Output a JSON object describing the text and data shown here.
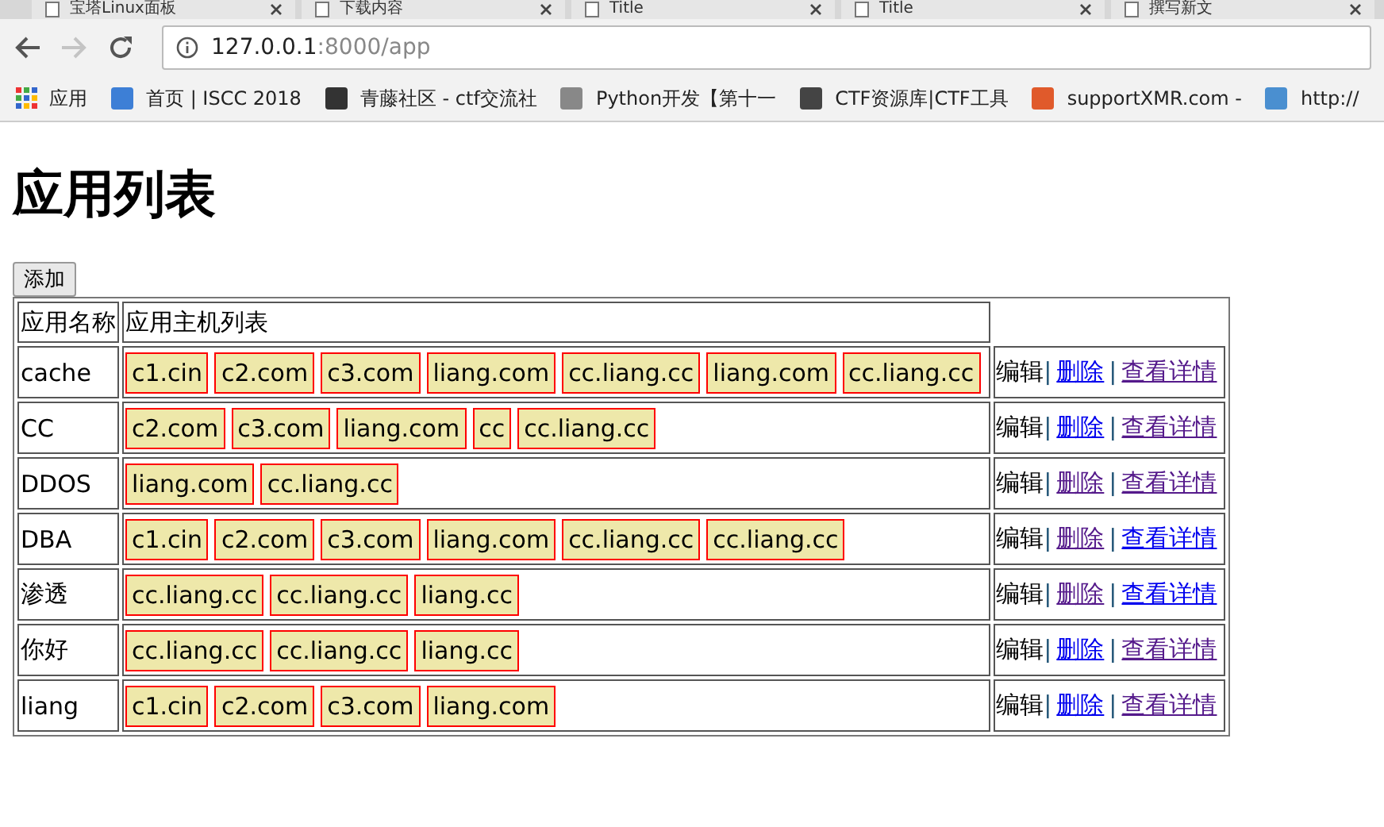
{
  "browser": {
    "tabs": [
      {
        "title": "宝塔Linux面板"
      },
      {
        "title": "下载内容"
      },
      {
        "title": "Title"
      },
      {
        "title": "Title"
      },
      {
        "title": "撰写新文"
      }
    ],
    "toolbar": {
      "forward_disabled": true,
      "address_host": "127.0.0.1",
      "address_path": ":8000/app"
    },
    "bookmarks": [
      {
        "label": "应用",
        "kind": "apps"
      },
      {
        "label": "首页 | ISCC 2018",
        "kind": "site"
      },
      {
        "label": "青藤社区 - ctf交流社",
        "kind": "site"
      },
      {
        "label": "Python开发【第十一",
        "kind": "site"
      },
      {
        "label": "CTF资源库|CTF工具",
        "kind": "site"
      },
      {
        "label": "supportXMR.com -",
        "kind": "site"
      },
      {
        "label": "http://",
        "kind": "site"
      }
    ]
  },
  "page": {
    "title": "应用列表",
    "add_button": "添加",
    "table": {
      "columns": [
        "应用名称",
        "应用主机列表"
      ],
      "rows": [
        {
          "name": "cache",
          "hosts": [
            "c1.cin",
            "c2.com",
            "c3.com",
            "liang.com",
            "cc.liang.cc",
            "liang.com",
            "cc.liang.cc"
          ],
          "actions": [
            {
              "kind": "text",
              "label": "编辑"
            },
            {
              "kind": "separator",
              "label": "|"
            },
            {
              "kind": "link",
              "label": "删除",
              "visited": false
            },
            {
              "kind": "separator",
              "label": "|"
            },
            {
              "kind": "link",
              "label": "查看详情",
              "visited": true
            }
          ]
        },
        {
          "name": "CC",
          "hosts": [
            "c2.com",
            "c3.com",
            "liang.com",
            "cc",
            "cc.liang.cc"
          ],
          "actions": [
            {
              "kind": "text",
              "label": "编辑"
            },
            {
              "kind": "separator",
              "label": "|"
            },
            {
              "kind": "link",
              "label": "删除",
              "visited": false
            },
            {
              "kind": "separator",
              "label": "|"
            },
            {
              "kind": "link",
              "label": "查看详情",
              "visited": true
            }
          ]
        },
        {
          "name": "DDOS",
          "hosts": [
            "liang.com",
            "cc.liang.cc"
          ],
          "actions": [
            {
              "kind": "text",
              "label": "编辑"
            },
            {
              "kind": "separator",
              "label": "|"
            },
            {
              "kind": "link",
              "label": "删除",
              "visited": true
            },
            {
              "kind": "separator",
              "label": "|"
            },
            {
              "kind": "link",
              "label": "查看详情",
              "visited": true
            }
          ]
        },
        {
          "name": "DBA",
          "hosts": [
            "c1.cin",
            "c2.com",
            "c3.com",
            "liang.com",
            "cc.liang.cc",
            "cc.liang.cc"
          ],
          "actions": [
            {
              "kind": "text",
              "label": "编辑"
            },
            {
              "kind": "separator",
              "label": "|"
            },
            {
              "kind": "link",
              "label": "删除",
              "visited": true
            },
            {
              "kind": "separator",
              "label": "|"
            },
            {
              "kind": "link",
              "label": "查看详情",
              "visited": false
            }
          ]
        },
        {
          "name": "渗透",
          "hosts": [
            "cc.liang.cc",
            "cc.liang.cc",
            "liang.cc"
          ],
          "actions": [
            {
              "kind": "text",
              "label": "编辑"
            },
            {
              "kind": "separator",
              "label": "|"
            },
            {
              "kind": "link",
              "label": "删除",
              "visited": true
            },
            {
              "kind": "separator",
              "label": "|"
            },
            {
              "kind": "link",
              "label": "查看详情",
              "visited": false
            }
          ]
        },
        {
          "name": "你好",
          "hosts": [
            "cc.liang.cc",
            "cc.liang.cc",
            "liang.cc"
          ],
          "actions": [
            {
              "kind": "text",
              "label": "编辑"
            },
            {
              "kind": "separator",
              "label": "|"
            },
            {
              "kind": "link",
              "label": "删除",
              "visited": false
            },
            {
              "kind": "separator",
              "label": "|"
            },
            {
              "kind": "link",
              "label": "查看详情",
              "visited": true
            }
          ]
        },
        {
          "name": "liang",
          "hosts": [
            "c1.cin",
            "c2.com",
            "c3.com",
            "liang.com"
          ],
          "actions": [
            {
              "kind": "text",
              "label": "编辑"
            },
            {
              "kind": "separator",
              "label": "|"
            },
            {
              "kind": "link",
              "label": "删除",
              "visited": false
            },
            {
              "kind": "separator",
              "label": "|"
            },
            {
              "kind": "link",
              "label": "查看详情",
              "visited": true
            }
          ]
        }
      ]
    }
  }
}
